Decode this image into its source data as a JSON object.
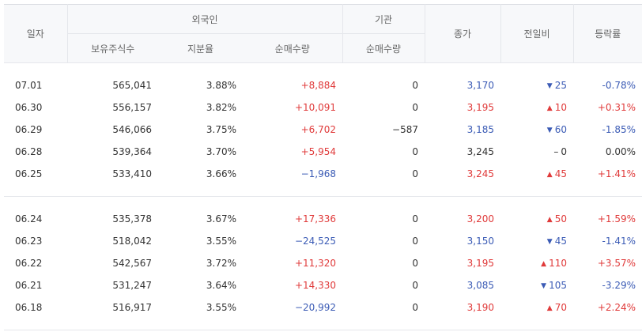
{
  "headers": {
    "date": "일자",
    "foreign_group": "외국인",
    "foreign_holdings": "보유주식수",
    "foreign_ratio": "지분율",
    "foreign_net": "순매수량",
    "inst_group": "기관",
    "inst_net": "순매수량",
    "close": "종가",
    "change": "전일비",
    "rate": "등락률"
  },
  "colors": {
    "up": "#e03a3a",
    "down": "#3b5bb5",
    "flat": "#333333"
  },
  "groups": [
    [
      {
        "date": "07.01",
        "holdings": "565,041",
        "ratio": "3.88%",
        "foreign_net": "+8,884",
        "inst_net": "0",
        "close": "3,170",
        "change_dir": "down",
        "change": "25",
        "rate": "-0.78%"
      },
      {
        "date": "06.30",
        "holdings": "556,157",
        "ratio": "3.82%",
        "foreign_net": "+10,091",
        "inst_net": "0",
        "close": "3,195",
        "change_dir": "up",
        "change": "10",
        "rate": "+0.31%"
      },
      {
        "date": "06.29",
        "holdings": "546,066",
        "ratio": "3.75%",
        "foreign_net": "+6,702",
        "inst_net": "−587",
        "close": "3,185",
        "change_dir": "down",
        "change": "60",
        "rate": "-1.85%"
      },
      {
        "date": "06.28",
        "holdings": "539,364",
        "ratio": "3.70%",
        "foreign_net": "+5,954",
        "inst_net": "0",
        "close": "3,245",
        "change_dir": "flat",
        "change": "0",
        "rate": "0.00%"
      },
      {
        "date": "06.25",
        "holdings": "533,410",
        "ratio": "3.66%",
        "foreign_net": "−1,968",
        "inst_net": "0",
        "close": "3,245",
        "change_dir": "up",
        "change": "45",
        "rate": "+1.41%"
      }
    ],
    [
      {
        "date": "06.24",
        "holdings": "535,378",
        "ratio": "3.67%",
        "foreign_net": "+17,336",
        "inst_net": "0",
        "close": "3,200",
        "change_dir": "up",
        "change": "50",
        "rate": "+1.59%"
      },
      {
        "date": "06.23",
        "holdings": "518,042",
        "ratio": "3.55%",
        "foreign_net": "−24,525",
        "inst_net": "0",
        "close": "3,150",
        "change_dir": "down",
        "change": "45",
        "rate": "-1.41%"
      },
      {
        "date": "06.22",
        "holdings": "542,567",
        "ratio": "3.72%",
        "foreign_net": "+11,320",
        "inst_net": "0",
        "close": "3,195",
        "change_dir": "up",
        "change": "110",
        "rate": "+3.57%"
      },
      {
        "date": "06.21",
        "holdings": "531,247",
        "ratio": "3.64%",
        "foreign_net": "+14,330",
        "inst_net": "0",
        "close": "3,085",
        "change_dir": "down",
        "change": "105",
        "rate": "-3.29%"
      },
      {
        "date": "06.18",
        "holdings": "516,917",
        "ratio": "3.55%",
        "foreign_net": "−20,992",
        "inst_net": "0",
        "close": "3,190",
        "change_dir": "up",
        "change": "70",
        "rate": "+2.24%"
      }
    ]
  ]
}
